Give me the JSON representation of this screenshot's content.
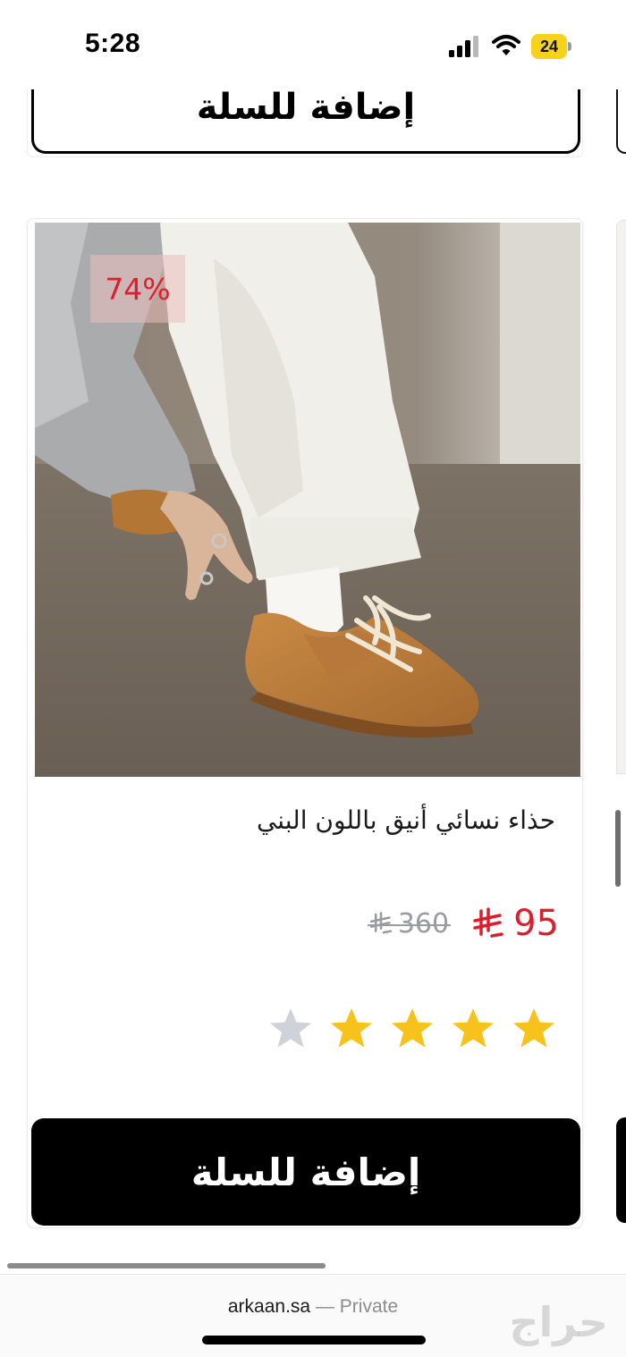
{
  "status_bar": {
    "time": "5:28",
    "battery_level": "24"
  },
  "prev_card": {
    "add_to_cart_label": "إضافة للسلة"
  },
  "product": {
    "discount_badge": "74%",
    "title": "حذاء نسائي أنيق باللون البني",
    "price_current": "95",
    "price_original": "360",
    "currency_symbol": "⃁",
    "rating": 4,
    "rating_max": 5,
    "add_to_cart_label": "إضافة للسلة",
    "image_description_icon": "product-photo"
  },
  "browser": {
    "domain": "arkaan.sa",
    "separator": "—",
    "mode": "Private"
  },
  "watermark": "حراج",
  "colors": {
    "price_red": "#d8202e",
    "star_gold": "#f6c21b",
    "star_gray": "#cfd2d8",
    "button_black": "#000000",
    "old_price_gray": "#9a9aa2"
  }
}
